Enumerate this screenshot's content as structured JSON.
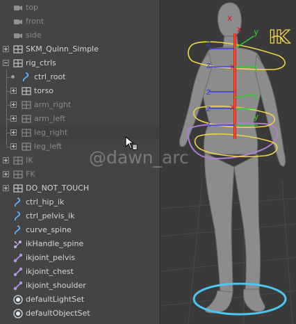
{
  "outliner": {
    "items": [
      {
        "label": "top",
        "icon": "camera-icon",
        "dim": true
      },
      {
        "label": "front",
        "icon": "camera-icon",
        "dim": true
      },
      {
        "label": "side",
        "icon": "camera-icon",
        "dim": true
      },
      {
        "label": "SKM_Quinn_Simple",
        "icon": "group-icon",
        "dim": false,
        "expander": "plus"
      },
      {
        "label": "rig_ctrls",
        "icon": "group-icon",
        "dim": false,
        "expander": "minus"
      },
      {
        "label": "ctrl_root",
        "icon": "curve-icon",
        "dim": false
      },
      {
        "label": "torso",
        "icon": "group-icon",
        "dim": false,
        "expander": "plus"
      },
      {
        "label": "arm_right",
        "icon": "group-icon",
        "dim": true,
        "expander": "plus"
      },
      {
        "label": "arm_left",
        "icon": "group-icon",
        "dim": true,
        "expander": "plus"
      },
      {
        "label": "leg_right",
        "icon": "group-icon",
        "dim": true,
        "expander": "plus"
      },
      {
        "label": "leg_left",
        "icon": "group-icon",
        "dim": true,
        "expander": "plus"
      },
      {
        "label": "IK",
        "icon": "group-icon",
        "dim": true,
        "expander": "plus"
      },
      {
        "label": "FK",
        "icon": "group-icon",
        "dim": true,
        "expander": "plus"
      },
      {
        "label": "DO_NOT_TOUCH",
        "icon": "group-icon",
        "dim": false,
        "expander": "plus"
      },
      {
        "label": "ctrl_hip_ik",
        "icon": "curve-icon",
        "dim": false
      },
      {
        "label": "ctrl_pelvis_ik",
        "icon": "curve-icon",
        "dim": false
      },
      {
        "label": "curve_spine",
        "icon": "curve-icon",
        "dim": false
      },
      {
        "label": "ikHandle_spine",
        "icon": "ik-handle-icon",
        "dim": false
      },
      {
        "label": "ikjoint_pelvis",
        "icon": "joint-icon",
        "dim": false
      },
      {
        "label": "ikjoint_chest",
        "icon": "joint-icon",
        "dim": false
      },
      {
        "label": "ikjoint_shoulder",
        "icon": "joint-icon",
        "dim": false
      },
      {
        "label": "defaultLightSet",
        "icon": "set-icon",
        "dim": false
      },
      {
        "label": "defaultObjectSet",
        "icon": "set-icon",
        "dim": false
      }
    ]
  },
  "viewport": {
    "ik_label": "IK",
    "watermark": "@dawn_arc",
    "axis_labels": {
      "x": "x",
      "y": "y",
      "z": "z"
    }
  },
  "colors": {
    "ik_yellow": "#f2d34a",
    "purple": "#b07cd8",
    "cyan": "#4cc6f0",
    "red": "#e0161a",
    "green": "#2bd12b",
    "blue": "#3a40e8"
  }
}
